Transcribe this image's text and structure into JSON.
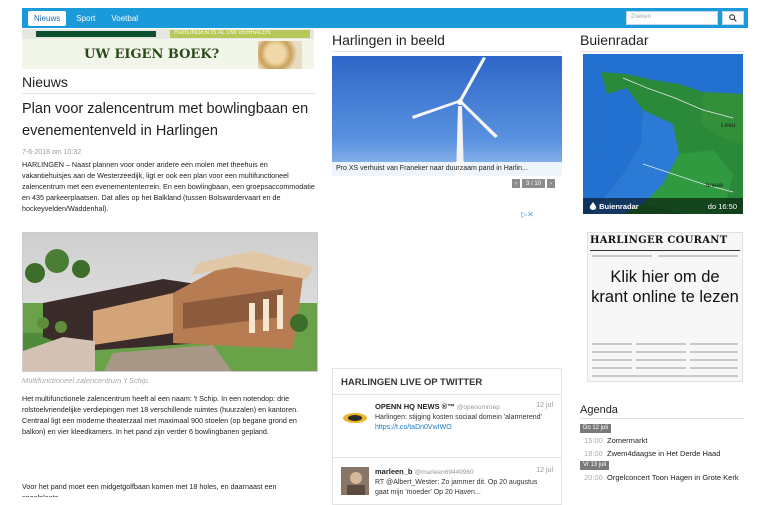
{
  "nav": {
    "items": [
      {
        "label": "Nieuws",
        "active": true
      },
      {
        "label": "Sport",
        "active": false
      },
      {
        "label": "Voetbal",
        "active": false
      }
    ],
    "search_placeholder": "Zoeken"
  },
  "banner": {
    "top_text": "HARLINGEN IS AL UW VERHALEN",
    "title": "UW EIGEN BOEK?"
  },
  "left": {
    "section_title": "Nieuws",
    "headline": "Plan voor zalencentrum met bowlingbaan en evenementenveld in Harlingen",
    "date": "7-6-2018 om 10:32",
    "body": "HARLINGEN – Naast plannen voor onder andere een molen met theehuis en vakantiehuisjes aan de Westerzeedijk, ligt er ook een plan voor een multifunctioneel zalencentrum met een evenemententerrein. En een bowlingbaan, een groepsaccommodatie en 435 parkeerplaatsen. Dat alles op het Balkland (tussen Bolswardervaart en de hockeyvelden/Waddenhal).",
    "image_caption": "Multifunctioneel zalencentrum 't Schip.",
    "body2": "Het multifunctionele zalencentrum heeft al een naam: 't Schip. In een notendop: drie rolstoelvriendelijke verdiepingen met 18 verschillende ruimtes (huurzalen) en kantoren. Centraal ligt een moderne theaterzaal met maximaal 900 stoelen (op begane grond en balkon) en vier kleedkamers. In het pand zijn verder 6 bowlingbanen gepland.",
    "body3": "Voor het pand moet een midgetgolfbaan komen met 18 holes, en daarnaast een speelplaats."
  },
  "middle": {
    "section_title": "Harlingen in beeld",
    "photo_caption": "Pro XS verhuist van Franeker naar duurzaam pand in Harlin...",
    "pager": {
      "prev": "‹",
      "counter": "3 / 10",
      "next": "›"
    },
    "ad_choices": "▷✕",
    "twitter": {
      "header": "HARLINGEN LIVE OP TWITTER",
      "tweets": [
        {
          "name": "OPENN HQ NEWS ®™",
          "handle": "@openomroep",
          "date": "12 jul",
          "text": "Harlingen: stijging kosten sociaal domein 'alarmerend' ",
          "link": "https://t.co/taDn0VwIWO"
        },
        {
          "name": "marleen_b",
          "handle": "@marleen69449960",
          "date": "12 jul",
          "text": "RT @Albert_Wester: Zo jammer dit. Op 20 augustus gaat mijn 'moeder' Op 20 Haven...",
          "link": ""
        }
      ]
    }
  },
  "right": {
    "radar_title": "Buienradar",
    "radar_brand": "Buienradar",
    "radar_time": "do 16:50",
    "radar_labels": [
      "Leeu",
      "Sneek"
    ],
    "courant_title": "HARLINGER COURANT",
    "courant_cta": "Klik hier om de krant online te lezen",
    "agenda_title": "Agenda",
    "agenda": [
      {
        "day": "Do 12 juli",
        "items": [
          {
            "time": "15:00",
            "event": "Zomermarkt"
          },
          {
            "time": "18:00",
            "event": "Zwem4daagse in Het Derde Haad"
          }
        ]
      },
      {
        "day": "Vr 13 juli",
        "items": [
          {
            "time": "20:00",
            "event": "Orgelconcert Toon Hagen in Grote Kerk"
          }
        ]
      }
    ]
  },
  "colors": {
    "nav_blue": "#1a9ad8",
    "link_blue": "#1a7ac8"
  }
}
